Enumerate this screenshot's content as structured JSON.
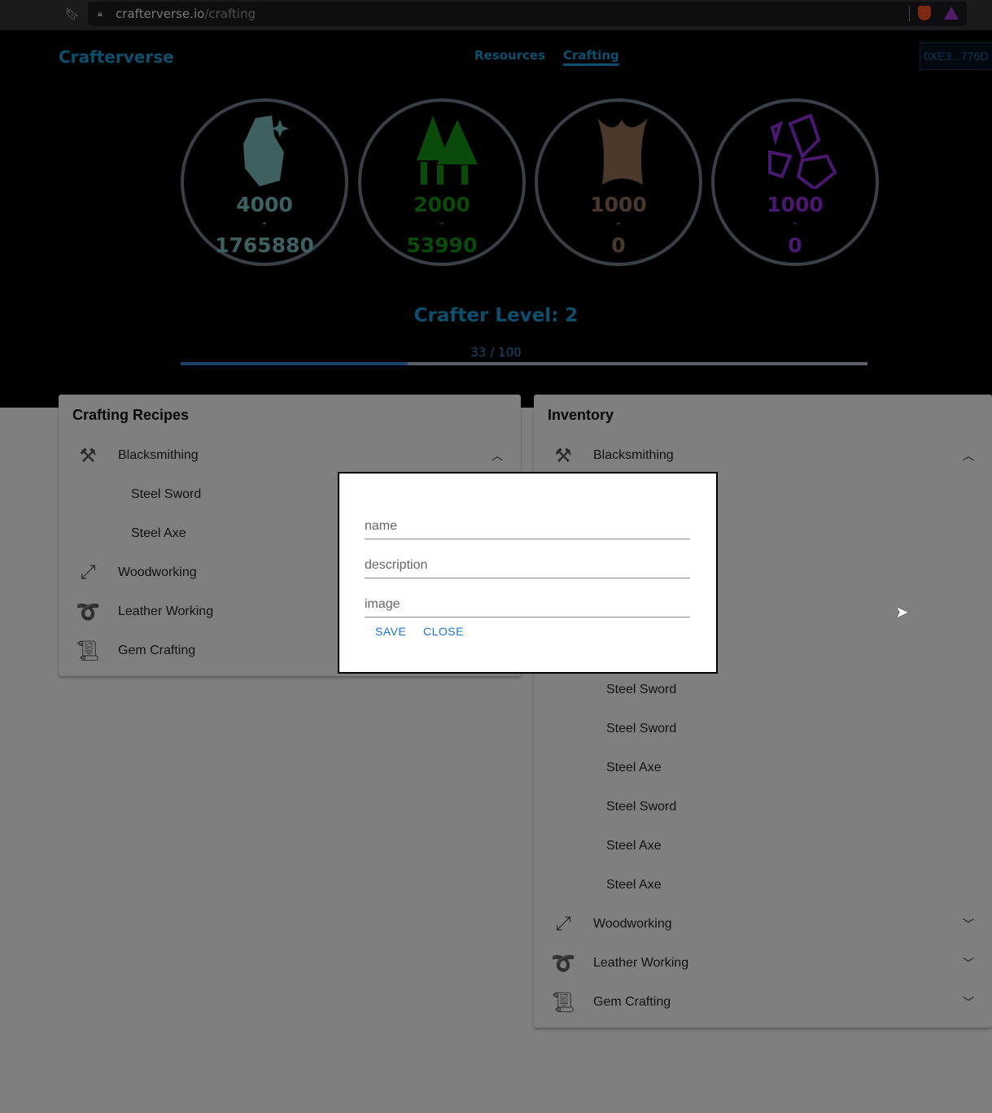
{
  "browser": {
    "url_host": "crafterverse.io",
    "url_path": "/crafting"
  },
  "header": {
    "brand": "Crafterverse",
    "nav": [
      {
        "label": "Resources",
        "active": false
      },
      {
        "label": "Crafting",
        "active": true
      }
    ],
    "wallet": "0XE3...776D"
  },
  "resources": [
    {
      "icon": "rock-icon",
      "color": "#7cc0c0",
      "amount": "4000",
      "sep": "-",
      "total": "1765880"
    },
    {
      "icon": "forest-icon",
      "color": "#149414",
      "amount": "2000",
      "sep": "-",
      "total": "53990"
    },
    {
      "icon": "leather-hide-icon",
      "color": "#947058",
      "amount": "1000",
      "sep": "-",
      "total": "0"
    },
    {
      "icon": "gems-icon",
      "color": "#9430e0",
      "amount": "1000",
      "sep": "-",
      "total": "0"
    }
  ],
  "level": {
    "title": "Crafter Level: 2",
    "xp": "33 / 100",
    "progress_percent": 33
  },
  "recipes": {
    "title": "Crafting Recipes",
    "categories": [
      {
        "label": "Blacksmithing",
        "icon": "anvil-icon",
        "expanded": true,
        "items": [
          "Steel Sword",
          "Steel Axe"
        ]
      },
      {
        "label": "Woodworking",
        "icon": "crossbow-icon"
      },
      {
        "label": "Leather Working",
        "icon": "needle-thread-icon"
      },
      {
        "label": "Gem Crafting",
        "icon": "scroll-quill-icon"
      }
    ]
  },
  "inventory": {
    "title": "Inventory",
    "categories": [
      {
        "label": "Blacksmithing",
        "icon": "anvil-icon",
        "expanded": true,
        "items": [
          "Steel Sword",
          "Steel Sword",
          "Steel Axe",
          "Steel Sword",
          "Steel Axe",
          "Steel Axe"
        ]
      },
      {
        "label": "Woodworking",
        "icon": "crossbow-icon"
      },
      {
        "label": "Leather Working",
        "icon": "needle-thread-icon"
      },
      {
        "label": "Gem Crafting",
        "icon": "scroll-quill-icon"
      }
    ]
  },
  "modal": {
    "name_placeholder": "name",
    "description_placeholder": "description",
    "image_placeholder": "image",
    "save": "SAVE",
    "close": "CLOSE"
  }
}
